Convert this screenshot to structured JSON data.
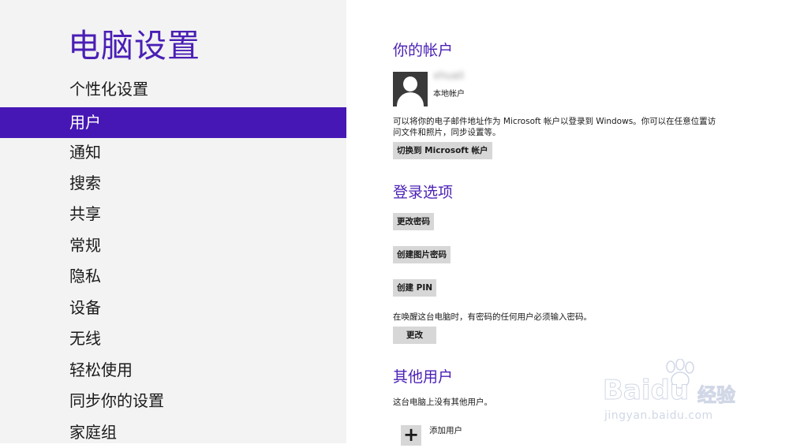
{
  "sidebar": {
    "title": "电脑设置",
    "items": [
      {
        "label": "个性化设置"
      },
      {
        "label": "用户"
      },
      {
        "label": "通知"
      },
      {
        "label": "搜索"
      },
      {
        "label": "共享"
      },
      {
        "label": "常规"
      },
      {
        "label": "隐私"
      },
      {
        "label": "设备"
      },
      {
        "label": "无线"
      },
      {
        "label": "轻松使用"
      },
      {
        "label": "同步你的设置"
      },
      {
        "label": "家庭组"
      }
    ],
    "selected_index": 1
  },
  "account": {
    "title": "你的帐户",
    "user_name": "xhuali",
    "account_type": "本地帐户",
    "description_line1": "可以将你的电子邮件地址作为 Microsoft 帐户以登录到 Windows。你可以在任意位置访",
    "description_line2": "问文件和照片，同步设置等。",
    "switch_button": "切换到 Microsoft 帐户"
  },
  "signin": {
    "title": "登录选项",
    "change_password_button": "更改密码",
    "picture_password_button": "创建图片密码",
    "pin_button": "创建 PIN",
    "wake_text": "在唤醒这台电脑时，有密码的任何用户必须输入密码。",
    "change_button": "更改"
  },
  "other_users": {
    "title": "其他用户",
    "none_text": "这台电脑上没有其他用户。",
    "add_user_label": "添加用户"
  },
  "watermark": {
    "brand": "Baidu",
    "brand_cn": "经验",
    "url": "jingyan.baidu.com"
  },
  "colors": {
    "accent": "#4617b4",
    "sidebar_bg": "#f3f3f3",
    "button_bg": "#d7d7d7"
  }
}
